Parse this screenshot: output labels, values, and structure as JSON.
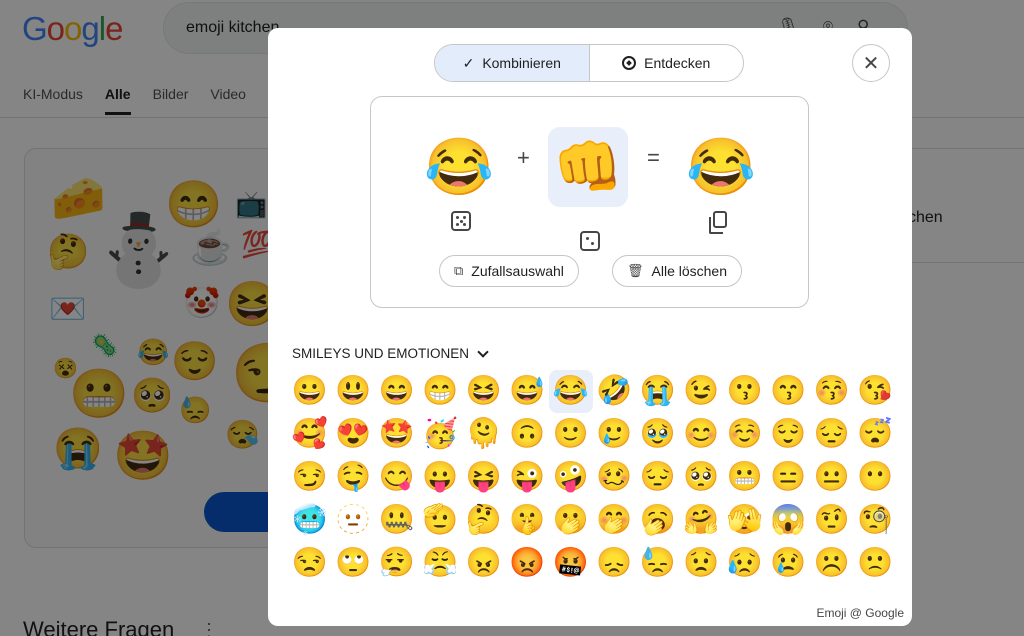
{
  "background": {
    "logo": [
      "G",
      "o",
      "o",
      "g",
      "l",
      "e"
    ],
    "search_query": "emoji kitchen",
    "tabs": [
      {
        "label": "KI-Modus",
        "active": false
      },
      {
        "label": "Alle",
        "active": true
      },
      {
        "label": "Bilder",
        "active": false
      },
      {
        "label": "Video",
        "active": false
      }
    ],
    "right_partial_text": "chen",
    "more_questions": "Weitere Fragen"
  },
  "modal": {
    "modes": [
      {
        "label": "Kombinieren",
        "icon": "check-icon",
        "active": true
      },
      {
        "label": "Entdecken",
        "icon": "compass-icon",
        "active": false
      }
    ],
    "close_icon": "close-icon",
    "mix": {
      "left": "😂",
      "plus": "+",
      "right": "👊",
      "equals": "=",
      "result": "😂"
    },
    "buttons": {
      "random": "Zufallsauswahl",
      "clear": "Alle löschen"
    },
    "category": "SMILEYS UND EMOTIONEN",
    "emojis": [
      "😀",
      "😃",
      "😄",
      "😁",
      "😆",
      "😅",
      "😂",
      "🤣",
      "😭",
      "😉",
      "😗",
      "😙",
      "😚",
      "😘",
      "🥰",
      "😍",
      "🤩",
      "🥳",
      "🫠",
      "🙃",
      "🙂",
      "🥲",
      "🥹",
      "😊",
      "☺️",
      "😌",
      "😔",
      "😴",
      "😏",
      "🤤",
      "😋",
      "😛",
      "😝",
      "😜",
      "🤪",
      "🥴",
      "😔",
      "🥺",
      "😬",
      "😑",
      "😐",
      "😶",
      "🥶",
      "🫥",
      "🤐",
      "🫡",
      "🤔",
      "🤫",
      "🫢",
      "🤭",
      "🥱",
      "🤗",
      "🫣",
      "😱",
      "🤨",
      "🧐",
      "😒",
      "🙄",
      "😮‍💨",
      "😤",
      "😠",
      "😡",
      "🤬",
      "😞",
      "😓",
      "😟",
      "😥",
      "😢",
      "☹️",
      "🙁"
    ],
    "selected_emoji_index": 6,
    "credit": "Emoji @ Google"
  },
  "colors": {
    "selected_bg": "#e8eefa",
    "active_segment": "#e3ecfb",
    "google_blue": "#0b57d0"
  }
}
